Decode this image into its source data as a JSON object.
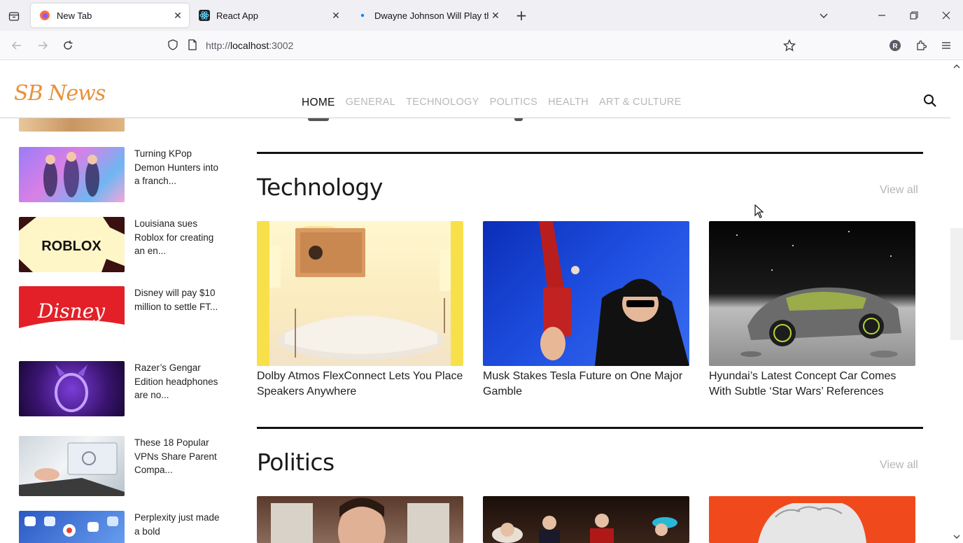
{
  "browser": {
    "tabs": [
      {
        "title": "New Tab",
        "active": true
      },
      {
        "title": "React App",
        "active": false
      },
      {
        "title": "Dwayne Johnson Will Play the C",
        "active": false
      }
    ],
    "url_prefix": "http://",
    "url_host": "localhost",
    "url_suffix": ":3002",
    "profile_initial": "R"
  },
  "site": {
    "logo": "SB News",
    "menu": [
      "HOME",
      "GENERAL",
      "TECHNOLOGY",
      "POLITICS",
      "HEALTH",
      "ART & CULTURE"
    ],
    "active_menu": "HOME"
  },
  "sidebar": {
    "items": [
      {
        "title": "Turning KPop Demon Hunters into a franch..."
      },
      {
        "title": "Louisiana sues Roblox for creating an en...",
        "image_text": "ROBLOX"
      },
      {
        "title": "Disney will pay $10 million to settle FT...",
        "image_text": "Disney"
      },
      {
        "title": "Razer’s Gengar Edition headphones are no..."
      },
      {
        "title": "These 18 Popular VPNs Share Parent Compa..."
      },
      {
        "title": "Perplexity just made a bold"
      }
    ]
  },
  "sections": {
    "technology": {
      "title": "Technology",
      "view_all": "View all",
      "cards": [
        {
          "title": "Dolby Atmos FlexConnect Lets You Place Speakers Anywhere"
        },
        {
          "title": "Musk Stakes Tesla Future on One Major Gamble"
        },
        {
          "title": "Hyundai’s Latest Concept Car Comes With Subtle ‘Star Wars’ References"
        }
      ]
    },
    "politics": {
      "title": "Politics",
      "view_all": "View all"
    }
  },
  "colors": {
    "logo": "#e8913a",
    "menu_inactive": "#b8b8b8",
    "menu_active": "#111111",
    "rule": "#111111"
  }
}
